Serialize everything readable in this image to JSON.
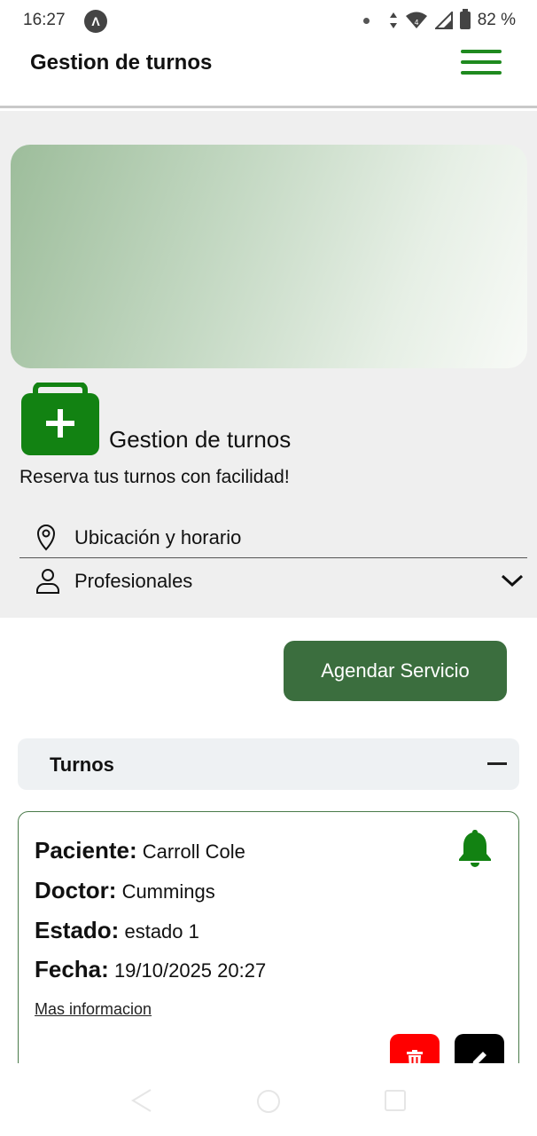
{
  "status_bar": {
    "time": "16:27",
    "app_icon_letter": "Λ",
    "signal_badge": "4",
    "battery": "82 %"
  },
  "app_bar": {
    "title": "Gestion de turnos",
    "menu_icon": "hamburger-menu-icon",
    "accent_color": "#1f8a1f"
  },
  "business": {
    "icon": "medical-kit-icon",
    "title": "Gestion de turnos",
    "subtitle": "Reserva tus turnos con facilidad!",
    "rows": [
      {
        "icon": "location-pin-icon",
        "label": "Ubicación y horario"
      },
      {
        "icon": "person-icon",
        "label": "Profesionales",
        "chevron": "chevron-down-icon"
      }
    ]
  },
  "actions": {
    "primary_label": "Agendar Servicio",
    "primary_color": "#3b6e3e"
  },
  "turnos": {
    "section_title": "Turnos",
    "expanded": true,
    "cards": [
      {
        "fields": [
          {
            "label": "Paciente:",
            "value": "Carroll Cole"
          },
          {
            "label": "Doctor:",
            "value": "Cummings"
          },
          {
            "label": "Estado:",
            "value": "estado 1"
          },
          {
            "label": "Fecha:",
            "value": "19/10/2025 20:27"
          }
        ],
        "link": "Mas informacion",
        "notification_icon": "bell-icon",
        "delete_icon": "trash-icon",
        "edit_icon": "pencil-icon"
      }
    ]
  }
}
